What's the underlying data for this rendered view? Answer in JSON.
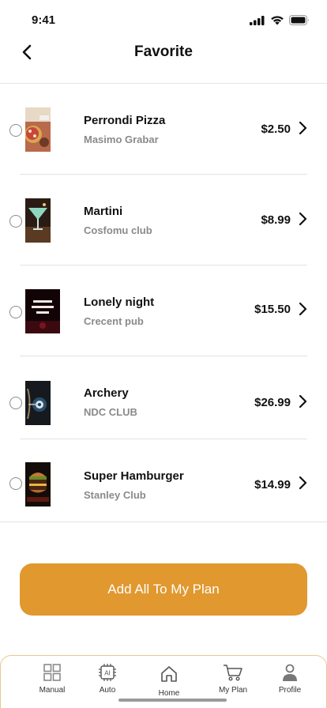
{
  "status_bar": {
    "time": "9:41"
  },
  "header": {
    "title": "Favorite",
    "back_icon": "chevron-left-icon"
  },
  "favorites": [
    {
      "name": "Perrondi Pizza",
      "venue": "Masimo Grabar",
      "price": "$2.50",
      "thumb_icon": "pizza-thumbnail"
    },
    {
      "name": "Martini",
      "venue": "Cosfomu club",
      "price": "$8.99",
      "thumb_icon": "martini-thumbnail"
    },
    {
      "name": "Lonely night",
      "venue": "Crecent pub",
      "price": "$15.50",
      "thumb_icon": "neon-sign-thumbnail"
    },
    {
      "name": "Archery",
      "venue": "NDC CLUB",
      "price": "$26.99",
      "thumb_icon": "archery-thumbnail"
    },
    {
      "name": "Super Hamburger",
      "venue": "Stanley Club",
      "price": "$14.99",
      "thumb_icon": "burger-thumbnail"
    }
  ],
  "actions": {
    "add_all_label": "Add All To My Plan"
  },
  "bottom_nav": [
    {
      "label": "Manual",
      "icon": "grid-icon"
    },
    {
      "label": "Auto",
      "icon": "ai-chip-icon"
    },
    {
      "label": "Home",
      "icon": "home-icon"
    },
    {
      "label": "My Plan",
      "icon": "cart-icon"
    },
    {
      "label": "Profile",
      "icon": "user-icon"
    }
  ],
  "colors": {
    "accent": "#E0982F",
    "nav_border": "#E8C98F"
  }
}
